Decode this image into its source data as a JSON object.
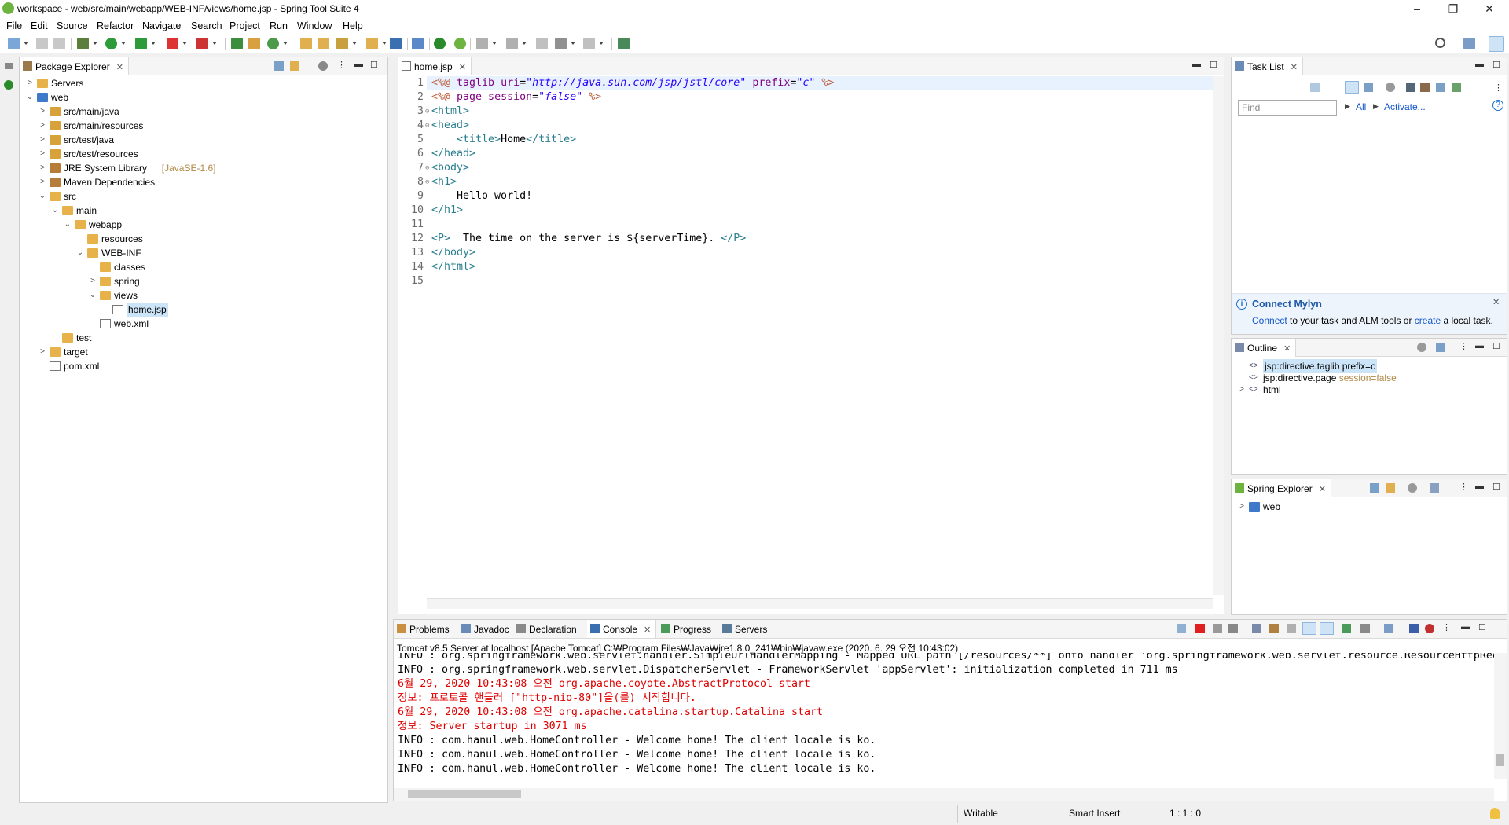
{
  "window": {
    "title": "workspace - web/src/main/webapp/WEB-INF/views/home.jsp - Spring Tool Suite 4",
    "min": "–",
    "max": "❐",
    "close": "✕"
  },
  "menu": [
    "File",
    "Edit",
    "Source",
    "Refactor",
    "Navigate",
    "Search",
    "Project",
    "Run",
    "Window",
    "Help"
  ],
  "package_explorer": {
    "tab": "Package Explorer",
    "tree": [
      {
        "label": "Servers",
        "depth": 0,
        "twisty": ">",
        "icon": "folder"
      },
      {
        "label": "web",
        "depth": 0,
        "twisty": "v",
        "icon": "proj"
      },
      {
        "label": "src/main/java",
        "depth": 1,
        "twisty": ">",
        "icon": "pkgf"
      },
      {
        "label": "src/main/resources",
        "depth": 1,
        "twisty": ">",
        "icon": "pkgf"
      },
      {
        "label": "src/test/java",
        "depth": 1,
        "twisty": ">",
        "icon": "pkgf"
      },
      {
        "label": "src/test/resources",
        "depth": 1,
        "twisty": ">",
        "icon": "pkgf"
      },
      {
        "label": "JRE System Library",
        "deco": "[JavaSE-1.6]",
        "depth": 1,
        "twisty": ">",
        "icon": "jar"
      },
      {
        "label": "Maven Dependencies",
        "depth": 1,
        "twisty": ">",
        "icon": "jar"
      },
      {
        "label": "src",
        "depth": 1,
        "twisty": "v",
        "icon": "folder"
      },
      {
        "label": "main",
        "depth": 2,
        "twisty": "v",
        "icon": "folder"
      },
      {
        "label": "webapp",
        "depth": 3,
        "twisty": "v",
        "icon": "folder"
      },
      {
        "label": "resources",
        "depth": 4,
        "twisty": "",
        "icon": "folder"
      },
      {
        "label": "WEB-INF",
        "depth": 4,
        "twisty": "v",
        "icon": "folder"
      },
      {
        "label": "classes",
        "depth": 5,
        "twisty": "",
        "icon": "folder"
      },
      {
        "label": "spring",
        "depth": 5,
        "twisty": ">",
        "icon": "folder"
      },
      {
        "label": "views",
        "depth": 5,
        "twisty": "v",
        "icon": "folder"
      },
      {
        "label": "home.jsp",
        "depth": 6,
        "twisty": "",
        "icon": "file",
        "selected": true
      },
      {
        "label": "web.xml",
        "depth": 5,
        "twisty": "",
        "icon": "file"
      },
      {
        "label": "test",
        "depth": 2,
        "twisty": "",
        "icon": "folder"
      },
      {
        "label": "target",
        "depth": 1,
        "twisty": ">",
        "icon": "folder"
      },
      {
        "label": "pom.xml",
        "depth": 1,
        "twisty": "",
        "icon": "file"
      }
    ]
  },
  "editor": {
    "tab": "home.jsp",
    "lines": [
      {
        "n": "1",
        "fold": "",
        "parts": [
          [
            "dir",
            "<%@ "
          ],
          [
            "attr",
            "taglib uri"
          ],
          [
            "",
            "="
          ],
          [
            "str",
            "\"http://java.sun.com/jsp/jstl/core\""
          ],
          [
            "attr",
            " prefix"
          ],
          [
            "",
            "="
          ],
          [
            "str",
            "\"c\""
          ],
          [
            "dir",
            " %>"
          ]
        ]
      },
      {
        "n": "2",
        "fold": "",
        "parts": [
          [
            "dir",
            "<%@ "
          ],
          [
            "attr",
            "page session"
          ],
          [
            "",
            "="
          ],
          [
            "str",
            "\"false\""
          ],
          [
            "dir",
            " %>"
          ]
        ]
      },
      {
        "n": "3",
        "fold": "⊖",
        "parts": [
          [
            "tag",
            "<html>"
          ]
        ]
      },
      {
        "n": "4",
        "fold": "⊖",
        "parts": [
          [
            "tag",
            "<head>"
          ]
        ]
      },
      {
        "n": "5",
        "fold": "",
        "parts": [
          [
            "",
            "    "
          ],
          [
            "tag",
            "<title>"
          ],
          [
            "",
            "Home"
          ],
          [
            "tag",
            "</title>"
          ]
        ]
      },
      {
        "n": "6",
        "fold": "",
        "parts": [
          [
            "tag",
            "</head>"
          ]
        ]
      },
      {
        "n": "7",
        "fold": "⊖",
        "parts": [
          [
            "tag",
            "<body>"
          ]
        ]
      },
      {
        "n": "8",
        "fold": "⊖",
        "parts": [
          [
            "tag",
            "<h1>"
          ]
        ]
      },
      {
        "n": "9",
        "fold": "",
        "parts": [
          [
            "",
            "    Hello world!"
          ]
        ]
      },
      {
        "n": "10",
        "fold": "",
        "parts": [
          [
            "tag",
            "</h1>"
          ]
        ]
      },
      {
        "n": "11",
        "fold": "",
        "parts": []
      },
      {
        "n": "12",
        "fold": "",
        "parts": [
          [
            "tag",
            "<P>"
          ],
          [
            "",
            "  The time on the server is ${serverTime}. "
          ],
          [
            "tag",
            "</P>"
          ]
        ]
      },
      {
        "n": "13",
        "fold": "",
        "parts": [
          [
            "tag",
            "</body>"
          ]
        ]
      },
      {
        "n": "14",
        "fold": "",
        "parts": [
          [
            "tag",
            "</html>"
          ]
        ]
      },
      {
        "n": "15",
        "fold": "",
        "parts": []
      }
    ]
  },
  "task_list": {
    "tab": "Task List",
    "find_placeholder": "Find",
    "all": "All",
    "activate": "Activate..."
  },
  "mylyn": {
    "title": "Connect Mylyn",
    "connect": "Connect",
    "middle": " to your task and ALM tools or ",
    "create": "create",
    "end": " a local task."
  },
  "outline": {
    "tab": "Outline",
    "items": [
      {
        "label": "jsp:directive.taglib prefix=c",
        "deco": "",
        "selected": true
      },
      {
        "label": "jsp:directive.page",
        "deco": " session=false",
        "selected": false
      },
      {
        "label": "html",
        "deco": "",
        "twisty": ">",
        "selected": false
      }
    ]
  },
  "spring_explorer": {
    "tab": "Spring Explorer",
    "items": [
      {
        "label": "web"
      }
    ]
  },
  "bottom_tabs": [
    "Problems",
    "Javadoc",
    "Declaration",
    "Console",
    "Progress",
    "Servers"
  ],
  "console": {
    "header": "Tomcat v8.5 Server at localhost [Apache Tomcat] C:₩Program Files₩Java₩jre1.8.0_241₩bin₩javaw.exe  (2020. 6. 29 오전 10:43:02)",
    "lines": [
      {
        "cls": "info",
        "text": "INFO : org.springframework.web.servlet.handler.SimpleUrlHandlerMapping - Mapped URL path [/resources/**] onto handler 'org.springframework.web.servlet.resource.ResourceHttpRequestHandler'"
      },
      {
        "cls": "info",
        "text": "INFO : org.springframework.web.servlet.DispatcherServlet - FrameworkServlet 'appServlet': initialization completed in 711 ms"
      },
      {
        "cls": "err",
        "text": "6월 29, 2020 10:43:08 오전 org.apache.coyote.AbstractProtocol start"
      },
      {
        "cls": "err",
        "text": "정보: 프로토콜 핸들러 [\"http-nio-80\"]을(를) 시작합니다."
      },
      {
        "cls": "err",
        "text": "6월 29, 2020 10:43:08 오전 org.apache.catalina.startup.Catalina start"
      },
      {
        "cls": "err",
        "text": "정보: Server startup in 3071 ms"
      },
      {
        "cls": "info",
        "text": "INFO : com.hanul.web.HomeController - Welcome home! The client locale is ko."
      },
      {
        "cls": "info",
        "text": "INFO : com.hanul.web.HomeController - Welcome home! The client locale is ko."
      },
      {
        "cls": "info",
        "text": "INFO : com.hanul.web.HomeController - Welcome home! The client locale is ko."
      }
    ]
  },
  "status": {
    "writable": "Writable",
    "insert": "Smart Insert",
    "position": "1 : 1 : 0"
  },
  "colors": {
    "accent": "#1155cc",
    "selected_bg": "#cce4f7",
    "error_text": "#e00000"
  }
}
